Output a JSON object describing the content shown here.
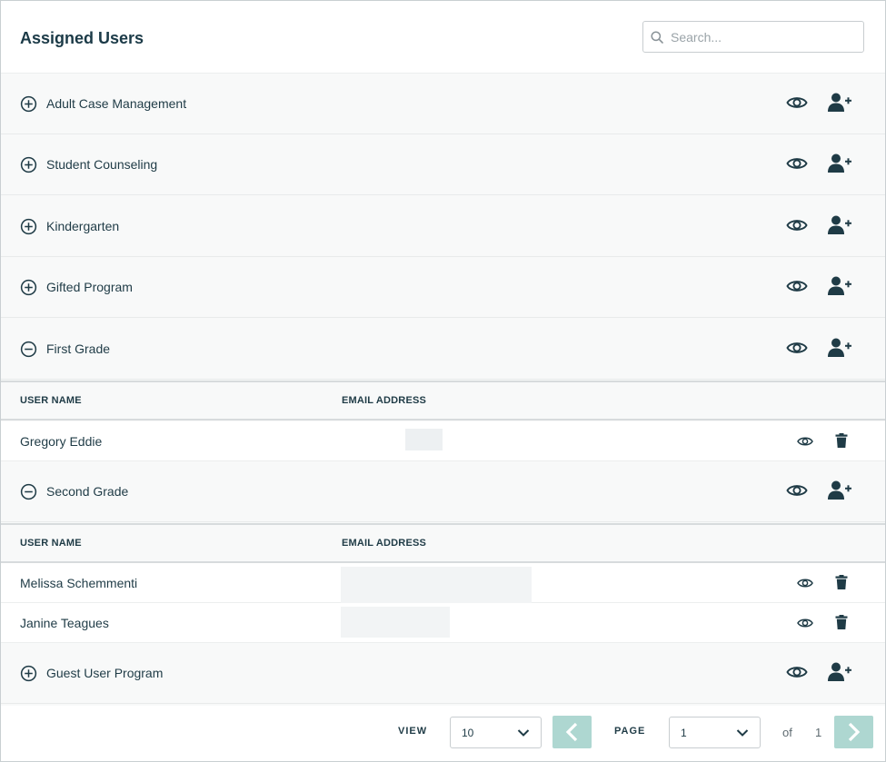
{
  "header": {
    "title": "Assigned Users",
    "search": {
      "placeholder": "Search...",
      "value": ""
    }
  },
  "table_headers": {
    "user_name": "USER NAME",
    "email_address": "EMAIL ADDRESS"
  },
  "groups": [
    {
      "name": "Adult Case Management",
      "expanded": false
    },
    {
      "name": "Student Counseling",
      "expanded": false
    },
    {
      "name": "Kindergarten",
      "expanded": false
    },
    {
      "name": "Gifted Program",
      "expanded": false
    },
    {
      "name": "First Grade",
      "expanded": true,
      "users": [
        {
          "name": "Gregory Eddie"
        }
      ]
    },
    {
      "name": "Second Grade",
      "expanded": true,
      "users": [
        {
          "name": "Melissa Schemmenti"
        },
        {
          "name": "Janine Teagues"
        }
      ]
    },
    {
      "name": "Guest User Program",
      "expanded": false
    }
  ],
  "footer": {
    "view_label": "VIEW",
    "view_value": "10",
    "page_label": "PAGE",
    "page_value": "1",
    "of_label": "of",
    "total_pages": "1"
  },
  "colors": {
    "text": "#1f3b46",
    "pager_button": "#aed7d1",
    "background": "#f8f9f9",
    "border": "#d7dbdd"
  },
  "icons": [
    "search-icon",
    "add-circle-icon",
    "remove-circle-icon",
    "eye-icon",
    "add-user-icon",
    "trash-icon",
    "chevron-down-icon",
    "chevron-left-icon",
    "chevron-right-icon"
  ]
}
